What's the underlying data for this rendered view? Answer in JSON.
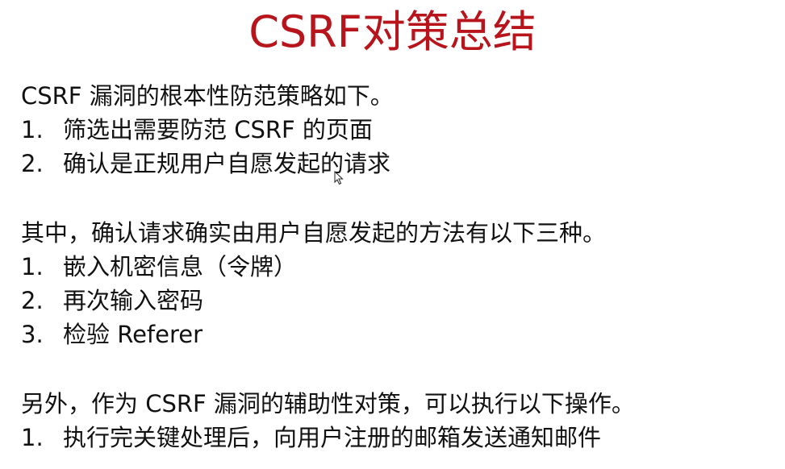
{
  "slide": {
    "title": "CSRF对策总结",
    "sections": [
      {
        "intro": "CSRF 漏洞的根本性防范策略如下。",
        "items": [
          {
            "number": "1.",
            "text": "筛选出需要防范 CSRF 的页面"
          },
          {
            "number": "2.",
            "text": "确认是正规用户自愿发起的请求"
          }
        ]
      },
      {
        "intro": "其中，确认请求确实由用户自愿发起的方法有以下三种。",
        "items": [
          {
            "number": "1.",
            "text": "嵌入机密信息（令牌）"
          },
          {
            "number": "2.",
            "text": "再次输入密码"
          },
          {
            "number": "3.",
            "text": "检验 Referer"
          }
        ]
      },
      {
        "intro": "另外，作为 CSRF 漏洞的辅助性对策，可以执行以下操作。",
        "items": [
          {
            "number": "1.",
            "text": "执行完关键处理后，向用户注册的邮箱发送通知邮件"
          }
        ]
      }
    ]
  },
  "colors": {
    "title": "#b8141c",
    "text": "#111111",
    "background": "#ffffff"
  },
  "icons": {
    "cursor": "mouse-pointer-icon"
  }
}
